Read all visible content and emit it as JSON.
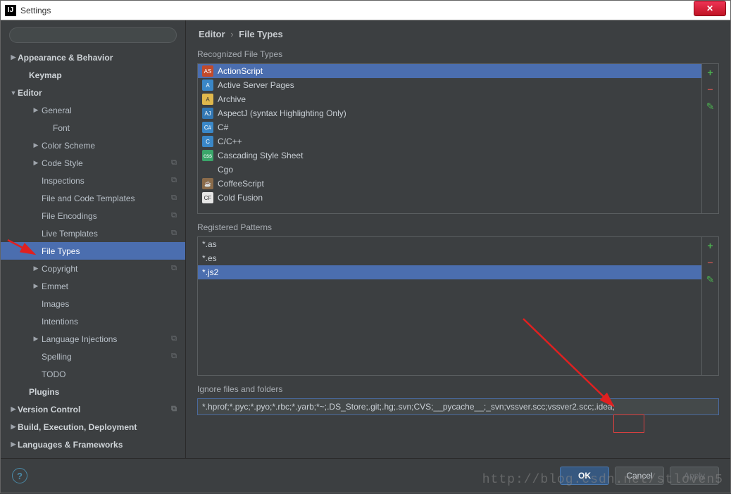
{
  "window": {
    "title": "Settings"
  },
  "sidebar": {
    "search_placeholder": "",
    "items": [
      {
        "label": "Appearance & Behavior",
        "level": 1,
        "arrow": "▶",
        "copy": false
      },
      {
        "label": "Keymap",
        "level": 2,
        "arrow": "",
        "copy": false
      },
      {
        "label": "Editor",
        "level": 1,
        "arrow": "▼",
        "copy": false
      },
      {
        "label": "General",
        "level": 3,
        "arrow": "▶",
        "copy": false
      },
      {
        "label": "Font",
        "level": 4,
        "arrow": "",
        "copy": false
      },
      {
        "label": "Color Scheme",
        "level": 3,
        "arrow": "▶",
        "copy": false
      },
      {
        "label": "Code Style",
        "level": 3,
        "arrow": "▶",
        "copy": true
      },
      {
        "label": "Inspections",
        "level": 3,
        "arrow": "",
        "copy": true
      },
      {
        "label": "File and Code Templates",
        "level": 3,
        "arrow": "",
        "copy": true
      },
      {
        "label": "File Encodings",
        "level": 3,
        "arrow": "",
        "copy": true
      },
      {
        "label": "Live Templates",
        "level": 3,
        "arrow": "",
        "copy": true
      },
      {
        "label": "File Types",
        "level": 3,
        "arrow": "",
        "copy": false,
        "selected": true
      },
      {
        "label": "Copyright",
        "level": 3,
        "arrow": "▶",
        "copy": true
      },
      {
        "label": "Emmet",
        "level": 3,
        "arrow": "▶",
        "copy": false
      },
      {
        "label": "Images",
        "level": 3,
        "arrow": "",
        "copy": false
      },
      {
        "label": "Intentions",
        "level": 3,
        "arrow": "",
        "copy": false
      },
      {
        "label": "Language Injections",
        "level": 3,
        "arrow": "▶",
        "copy": true
      },
      {
        "label": "Spelling",
        "level": 3,
        "arrow": "",
        "copy": true
      },
      {
        "label": "TODO",
        "level": 3,
        "arrow": "",
        "copy": false
      },
      {
        "label": "Plugins",
        "level": 2,
        "arrow": "",
        "copy": false
      },
      {
        "label": "Version Control",
        "level": 1,
        "arrow": "▶",
        "copy": true
      },
      {
        "label": "Build, Execution, Deployment",
        "level": 1,
        "arrow": "▶",
        "copy": false
      },
      {
        "label": "Languages & Frameworks",
        "level": 1,
        "arrow": "▶",
        "copy": false
      }
    ]
  },
  "breadcrumb": {
    "root": "Editor",
    "leaf": "File Types",
    "sep": "›"
  },
  "recognized": {
    "label": "Recognized File Types",
    "items": [
      {
        "label": "ActionScript",
        "selected": true,
        "bg": "#c24a2b",
        "fg": "#fff",
        "abbr": "AS"
      },
      {
        "label": "Active Server Pages",
        "bg": "#3a87c7",
        "fg": "#fff",
        "abbr": "A"
      },
      {
        "label": "Archive",
        "bg": "#e0b84c",
        "fg": "#333",
        "abbr": "A"
      },
      {
        "label": "AspectJ (syntax Highlighting Only)",
        "bg": "#3277b3",
        "fg": "#fff",
        "abbr": "AJ"
      },
      {
        "label": "C#",
        "bg": "#3a87c7",
        "fg": "#fff",
        "abbr": "C#"
      },
      {
        "label": "C/C++",
        "bg": "#3a87c7",
        "fg": "#fff",
        "abbr": "C"
      },
      {
        "label": "Cascading Style Sheet",
        "bg": "#3aa66a",
        "fg": "#fff",
        "abbr": "css"
      },
      {
        "label": "Cgo",
        "bg": "transparent",
        "fg": "#bbb",
        "abbr": ""
      },
      {
        "label": "CoffeeScript",
        "bg": "#8a6b4a",
        "fg": "#fff",
        "abbr": "☕"
      },
      {
        "label": "Cold Fusion",
        "bg": "#e6e6e6",
        "fg": "#333",
        "abbr": "CF"
      }
    ]
  },
  "patterns": {
    "label": "Registered Patterns",
    "items": [
      {
        "label": "*.as"
      },
      {
        "label": "*.es"
      },
      {
        "label": "*.js2",
        "selected": true
      }
    ]
  },
  "ignore": {
    "label": "Ignore files and folders",
    "value": "*.hprof;*.pyc;*.pyo;*.rbc;*.yarb;*~;.DS_Store;.git;.hg;.svn;CVS;__pycache__;_svn;vssver.scc;vssver2.scc;.idea;"
  },
  "buttons": {
    "ok": "OK",
    "cancel": "Cancel",
    "apply": "Apply"
  },
  "watermark": "http://blog.csdn.net/stloven5"
}
